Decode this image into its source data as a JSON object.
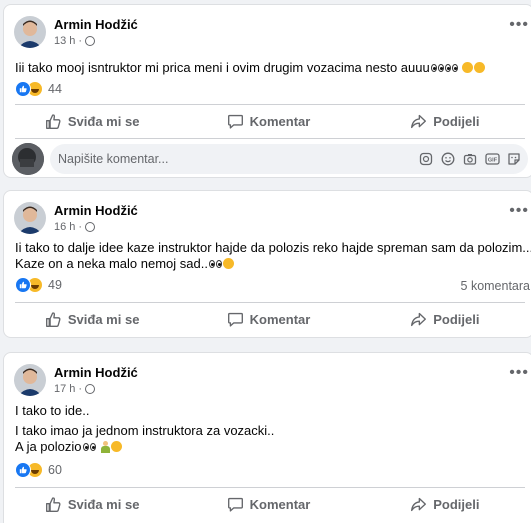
{
  "posts": [
    {
      "author": "Armin Hodžić",
      "time": "13 h",
      "lines": [
        "Iii tako mooj isntruktor mi prica meni i ovim drugim vozacima nesto auuu"
      ],
      "reaction_count": "44",
      "comments_label": "",
      "actions": {
        "like": "Sviđa mi se",
        "comment": "Komentar",
        "share": "Podijeli"
      },
      "composer_placeholder": "Napišite komentar..."
    },
    {
      "author": "Armin Hodžić",
      "time": "16 h",
      "lines": [
        "Ii tako to dalje idee kaze instruktor hajde da polozis reko hajde spreman sam da polozim...",
        "Kaze on a neka malo nemoj sad.."
      ],
      "reaction_count": "49",
      "comments_label": "5 komentara",
      "actions": {
        "like": "Sviđa mi se",
        "comment": "Komentar",
        "share": "Podijeli"
      }
    },
    {
      "author": "Armin Hodžić",
      "time": "17 h",
      "lines": [
        "I tako to ide..",
        "I tako imao ja jednom instruktora za vozacki..",
        "A ja polozio"
      ],
      "reaction_count": "60",
      "comments_label": "",
      "actions": {
        "like": "Sviđa mi se",
        "comment": "Komentar",
        "share": "Podijeli"
      }
    }
  ],
  "icons": {
    "privacy": "globe-icon",
    "more": "more-options-icon",
    "like": "thumbs-up-icon",
    "comment": "comment-bubble-icon",
    "share": "share-arrow-icon",
    "composer": [
      "sticker-icon",
      "emoji-icon",
      "camera-icon",
      "gif-icon",
      "sticker-smile-icon"
    ]
  },
  "colors": {
    "accent": "#1877f2",
    "muted": "#65676b",
    "background": "#f0f2f5"
  }
}
